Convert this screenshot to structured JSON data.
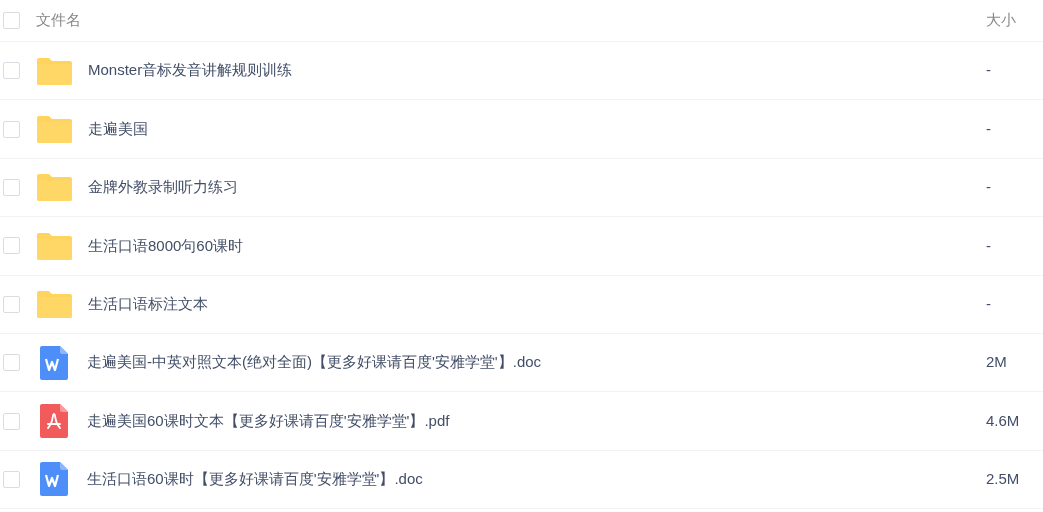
{
  "header": {
    "checked": false,
    "name_label": "文件名",
    "size_label": "大小"
  },
  "files": [
    {
      "kind": "folder",
      "name": "Monster音标发音讲解规则训练",
      "size": "-",
      "checked": false
    },
    {
      "kind": "folder",
      "name": "走遍美国",
      "size": "-",
      "checked": false
    },
    {
      "kind": "folder",
      "name": "金牌外教录制听力练习",
      "size": "-",
      "checked": false
    },
    {
      "kind": "folder",
      "name": "生活口语8000句60课时",
      "size": "-",
      "checked": false
    },
    {
      "kind": "folder",
      "name": "生活口语标注文本",
      "size": "-",
      "checked": false
    },
    {
      "kind": "doc",
      "name": "走遍美国-中英对照文本(绝对全面)【更多好课请百度'安雅学堂'】.doc",
      "size": "2M",
      "checked": false
    },
    {
      "kind": "pdf",
      "name": "走遍美国60课时文本【更多好课请百度'安雅学堂'】.pdf",
      "size": "4.6M",
      "checked": false
    },
    {
      "kind": "doc",
      "name": "生活口语60课时【更多好课请百度'安雅学堂'】.doc",
      "size": "2.5M",
      "checked": false
    }
  ]
}
